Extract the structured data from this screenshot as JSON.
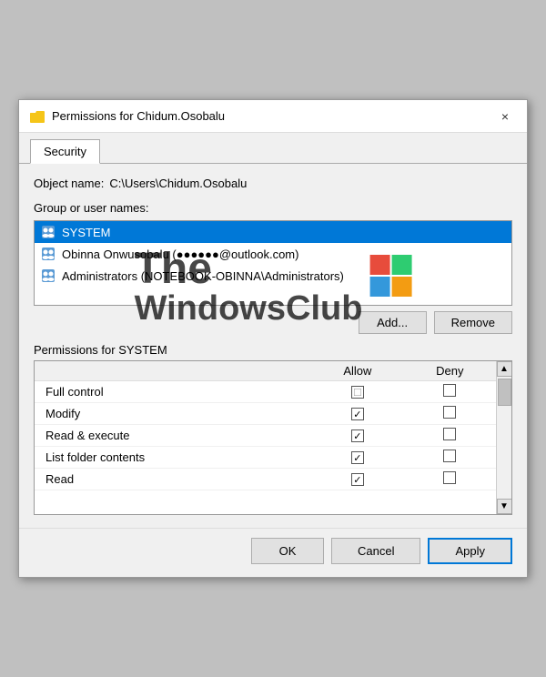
{
  "dialog": {
    "title": "Permissions for Chidum.Osobalu",
    "title_icon": "folder",
    "close_label": "×"
  },
  "tabs": [
    {
      "label": "Security",
      "active": true
    }
  ],
  "object": {
    "label": "Object name:",
    "value": "C:\\Users\\Chidum.Osobalu"
  },
  "group_section": {
    "label": "Group or user names:"
  },
  "users": [
    {
      "name": "SYSTEM",
      "selected": true
    },
    {
      "name": "Obinna Onwusobalu (●●●●●●@outlook.com)",
      "selected": false
    },
    {
      "name": "Administrators (NOTEBOOK-OBINNA\\Administrators)",
      "selected": false
    }
  ],
  "buttons": {
    "add": "Add...",
    "remove": "Remove"
  },
  "permissions_header": "Permissions for SYSTEM",
  "columns": {
    "permission": "",
    "allow": "Allow",
    "deny": "Deny"
  },
  "permissions": [
    {
      "name": "Full control",
      "allow": true,
      "allow_indeterminate": true,
      "deny": false
    },
    {
      "name": "Modify",
      "allow": true,
      "allow_indeterminate": false,
      "deny": false
    },
    {
      "name": "Read & execute",
      "allow": true,
      "allow_indeterminate": false,
      "deny": false
    },
    {
      "name": "List folder contents",
      "allow": true,
      "allow_indeterminate": false,
      "deny": false
    },
    {
      "name": "Read",
      "allow": true,
      "allow_indeterminate": false,
      "deny": false
    }
  ],
  "footer": {
    "ok": "OK",
    "cancel": "Cancel",
    "apply": "Apply"
  },
  "watermark": {
    "line1": "The",
    "line2": "WindowsClub"
  }
}
